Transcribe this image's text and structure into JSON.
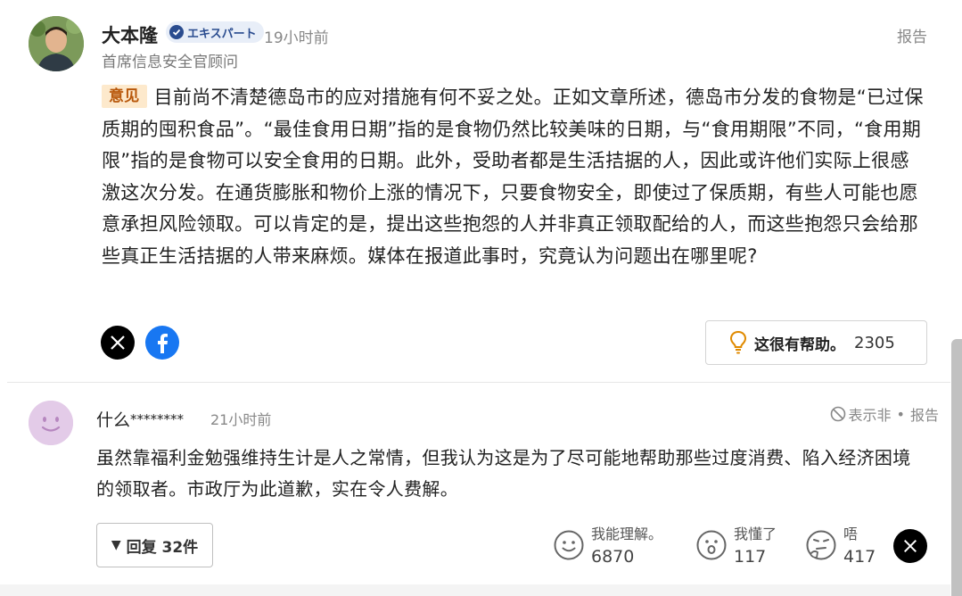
{
  "expert": {
    "name": "大本隆",
    "badge": "エキスパート",
    "time": "19小时前",
    "report": "报告",
    "role": "首席信息安全官顾问",
    "tag": "意见",
    "body": "目前尚不清楚德岛市的应对措施有何不妥之处。正如文章所述，德岛市分发的食物是“已过保质期的囤积食品”。“最佳食用日期”指的是食物仍然比较美味的日期，与“食用期限”不同，“食用期限”指的是食物可以安全食用的日期。此外，受助者都是生活拮据的人，因此或许他们实际上很感激这次分发。在通货膨胀和物价上涨的情况下，只要食物安全，即使过了保质期，有些人可能也愿意承担风险领取。可以肯定的是，提出这些抱怨的人并非真正领取配给的人，而这些抱怨只会给那些真正生活拮据的人带来麻烦。媒体在报道此事时，究竟认为问题出在哪里呢?",
    "helpful_label": "这很有帮助。",
    "helpful_count": "2305",
    "colors": {
      "badge_bg": "#e8eef8",
      "tag_bg": "#fde9cc",
      "tag_text": "#b8570a",
      "facebook": "#1877f2"
    }
  },
  "user": {
    "name": "什么",
    "name_mask": "********",
    "time": "21小时前",
    "hide": "表示非",
    "separator": "•",
    "report": "报告",
    "body": "虽然靠福利金勉强维持生计是人之常情，但我认为这是为了尽可能地帮助那些过度消费、陷入经济困境的领取者。市政厅为此道歉，实在令人费解。",
    "replies": "回复 32件",
    "reactions": [
      {
        "icon": "smile-face-icon",
        "label": "我能理解。",
        "count": "6870"
      },
      {
        "icon": "surprised-face-icon",
        "label": "我懂了",
        "count": "117"
      },
      {
        "icon": "thinking-face-icon",
        "label": "唔",
        "count": "417"
      }
    ],
    "colors": {
      "avatar": "#e3cbe8"
    }
  }
}
